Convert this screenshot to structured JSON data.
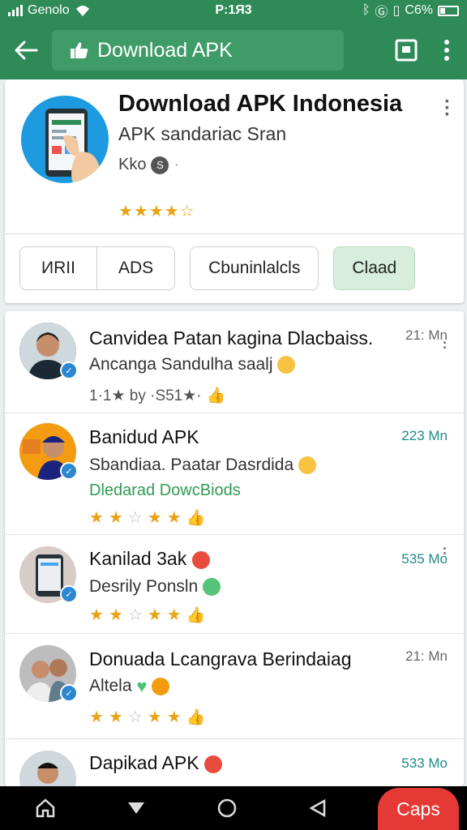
{
  "status_bar": {
    "carrier": "Genolo",
    "time": "P:1Я3",
    "battery": "C6%"
  },
  "toolbar": {
    "search_text": "Download APK"
  },
  "app": {
    "title": "Download APK Indonesia",
    "subtitle": "APK sandariac Sran",
    "meta": "Kko",
    "rating_stars": "★★★★☆",
    "rating_value": 4.5
  },
  "tabs": {
    "group": [
      "ИRII",
      "ADS"
    ],
    "filter": "Cbuninlalcls",
    "active": "Claad"
  },
  "reviews": [
    {
      "title": "Canvidea Patan kagina Dlacbaiss.",
      "text": "Ancanga Sandulha saalj",
      "stats": "1·1★  by ·S51★·",
      "time": "21: Mn"
    },
    {
      "title": "Banidud APK",
      "text": "Sbandiaa. Paatar Dasrdida",
      "sub": "Dledarad DowcBiods",
      "time": "223 Mn"
    },
    {
      "title": "Kanilad 3ak",
      "text": "Desrily Ponsln",
      "time": "535 Mo"
    },
    {
      "title": "Donuada Lcangrava  Berindaiag",
      "text": "Altela",
      "time": "21: Mn"
    },
    {
      "title": "Dapikad APK",
      "time": "533 Mo"
    }
  ],
  "nav": {
    "caps_label": "Caps"
  }
}
